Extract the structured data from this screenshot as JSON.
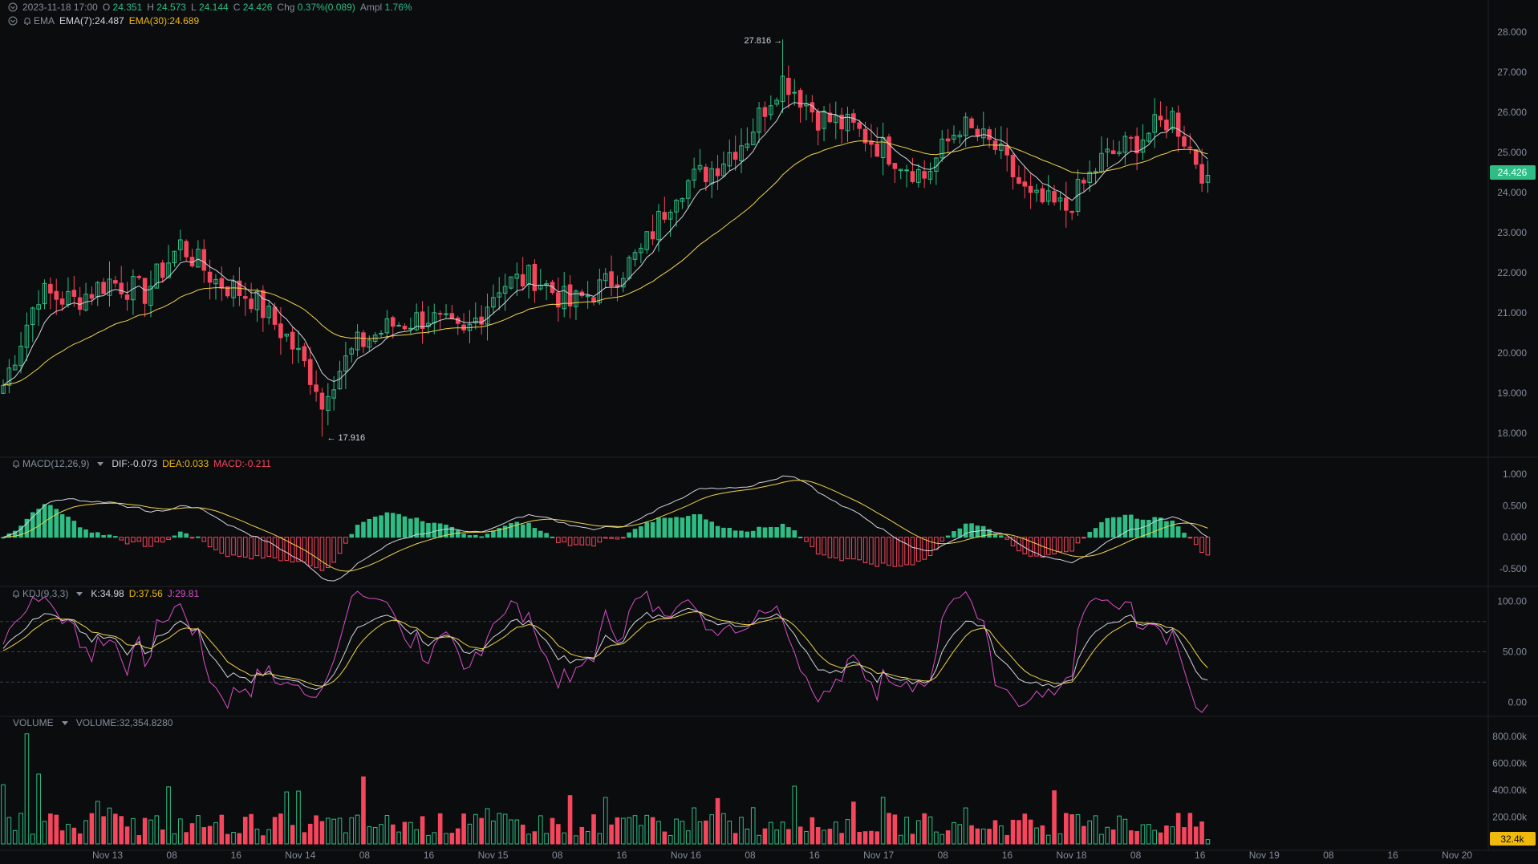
{
  "colors": {
    "bg": "#0b0c0e",
    "up": "#2ebd85",
    "down": "#f6465d",
    "grid": "#1e2126",
    "axis": "#848e9c",
    "ema7": "#d1d4dc",
    "ema30": "#f0d24b",
    "kdj_k": "#d1d4dc",
    "kdj_d": "#f0d24b",
    "kdj_j": "#d84fc8",
    "price_tag": "#2ebd85",
    "volume_tag": "#f0b90b"
  },
  "header": {
    "datetime": "2023-11-18 17:00",
    "open_label": "O",
    "open": "24.351",
    "high_label": "H",
    "high": "24.573",
    "low_label": "L",
    "low": "24.144",
    "close_label": "C",
    "close": "24.426",
    "chg_label": "Chg",
    "chg": "0.37%(0.089)",
    "ampl_label": "Ampl",
    "ampl": "1.76%",
    "ema_label": "EMA",
    "ema7": "EMA(7):24.487",
    "ema30": "EMA(30):24.689"
  },
  "macd_header": {
    "label": "MACD(12,26,9)",
    "dif": "DIF:-0.073",
    "dea": "DEA:0.033",
    "macd": "MACD:-0.211"
  },
  "kdj_header": {
    "label": "KDJ(9,3,3)",
    "k": "K:34.98",
    "d": "D:37.56",
    "j": "J:29.81"
  },
  "volume_header": {
    "label": "VOLUME",
    "value": "VOLUME:32,354.8280"
  },
  "chart_data": {
    "type": "candlestick",
    "price_axis": {
      "ylim": [
        17.5,
        28.3
      ],
      "ticks": [
        18,
        19,
        20,
        21,
        22,
        23,
        24,
        25,
        26,
        27,
        28
      ],
      "tick_labels": [
        "18.000",
        "19.000",
        "20.000",
        "21.000",
        "22.000",
        "23.000",
        "24.000",
        "25.000",
        "26.000",
        "27.000",
        "28.000"
      ]
    },
    "x_ticks": [
      "Nov 13",
      "08",
      "16",
      "Nov 14",
      "08",
      "16",
      "Nov 15",
      "08",
      "16",
      "Nov 16",
      "08",
      "16",
      "Nov 17",
      "08",
      "16",
      "Nov 18",
      "08",
      "16",
      "Nov 19",
      "08",
      "16",
      "Nov 20"
    ],
    "high_annotation": "27.816 →",
    "low_annotation": "← 17.916",
    "last_price": "24.426",
    "last_volume": "32.4k",
    "close_anchors": [
      [
        0,
        19.2
      ],
      [
        6,
        21.5
      ],
      [
        12,
        21.3
      ],
      [
        18,
        21.8
      ],
      [
        24,
        21.5
      ],
      [
        30,
        22.7
      ],
      [
        36,
        21.8
      ],
      [
        42,
        21.4
      ],
      [
        48,
        20.4
      ],
      [
        54,
        19.0
      ],
      [
        60,
        20.2
      ],
      [
        66,
        20.7
      ],
      [
        72,
        20.9
      ],
      [
        78,
        20.4
      ],
      [
        84,
        21.7
      ],
      [
        90,
        21.9
      ],
      [
        96,
        21.2
      ],
      [
        102,
        21.7
      ],
      [
        108,
        22.5
      ],
      [
        114,
        24.1
      ],
      [
        120,
        24.6
      ],
      [
        126,
        25.4
      ],
      [
        132,
        26.9
      ],
      [
        138,
        25.9
      ],
      [
        144,
        25.6
      ],
      [
        150,
        25.0
      ],
      [
        156,
        24.4
      ],
      [
        162,
        25.7
      ],
      [
        168,
        25.1
      ],
      [
        174,
        23.8
      ],
      [
        180,
        23.6
      ],
      [
        186,
        24.8
      ],
      [
        192,
        25.3
      ],
      [
        198,
        25.9
      ],
      [
        204,
        24.3
      ]
    ],
    "macd_axis": {
      "ylim": [
        -0.7,
        1.2
      ],
      "ticks": [
        1.0,
        0.5,
        0.0,
        -0.5
      ],
      "tick_labels": [
        "1.000",
        "0.500",
        "0.000",
        "-0.500"
      ]
    },
    "kdj_axis": {
      "ylim": [
        -10,
        110
      ],
      "ticks": [
        100,
        50,
        0
      ],
      "tick_labels": [
        "100.00",
        "50.00",
        "0.00"
      ]
    },
    "volume_axis": {
      "ylim": [
        0,
        920000
      ],
      "ticks": [
        800000,
        600000,
        400000,
        200000
      ],
      "tick_labels": [
        "800.00k",
        "600.00k",
        "400.00k",
        "200.00k"
      ]
    }
  }
}
